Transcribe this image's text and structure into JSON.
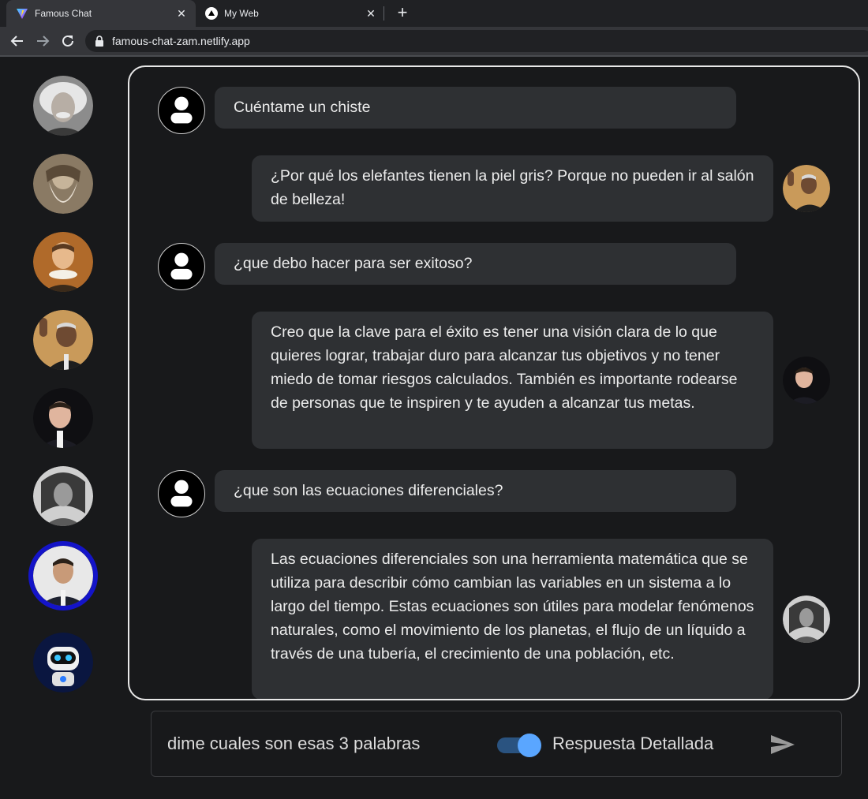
{
  "browser": {
    "tabs": [
      {
        "title": "Famous Chat",
        "active": true
      },
      {
        "title": "My Web",
        "active": false
      }
    ],
    "url": "famous-chat-zam.netlify.app"
  },
  "sidebar": {
    "characters": [
      {
        "name": "einstein",
        "selected": false
      },
      {
        "name": "leonardo",
        "selected": false
      },
      {
        "name": "shakespeare",
        "selected": false
      },
      {
        "name": "mandela",
        "selected": false
      },
      {
        "name": "musk",
        "selected": false
      },
      {
        "name": "beyonce",
        "selected": false
      },
      {
        "name": "ronaldo",
        "selected": true
      },
      {
        "name": "robot",
        "selected": false
      }
    ]
  },
  "chat": {
    "messages": [
      {
        "role": "user",
        "text": "Cuéntame un chiste"
      },
      {
        "role": "bot",
        "text": "¿Por qué los elefantes tienen la piel gris? Porque no pueden ir al salón de belleza!"
      },
      {
        "role": "user",
        "text": "¿que debo hacer para ser exitoso?"
      },
      {
        "role": "bot",
        "text": "Creo que la clave para el éxito es tener una visión clara de lo que quieres lograr, trabajar duro para alcanzar tus objetivos y no tener miedo de tomar riesgos calculados. También es importante rodearse de personas que te inspiren y te ayuden a alcanzar tus metas."
      },
      {
        "role": "user",
        "text": "¿que son las ecuaciones diferenciales?"
      },
      {
        "role": "bot",
        "text": "Las ecuaciones diferenciales son una herramienta matemática que se utiliza para describir cómo cambian las variables en un sistema a lo largo del tiempo. Estas ecuaciones son útiles para modelar fenómenos naturales, como el movimiento de los planetas, el flujo de un líquido a través de una tubería, el crecimiento de una población, etc."
      }
    ]
  },
  "input": {
    "value": "dime cuales son esas 3 palabras",
    "toggle_label": "Respuesta Detallada",
    "toggle_on": true
  },
  "colors": {
    "selected_ring": "#1414c8",
    "toggle_knob": "#5aa6ff",
    "bubble_bg": "#2e3033"
  }
}
